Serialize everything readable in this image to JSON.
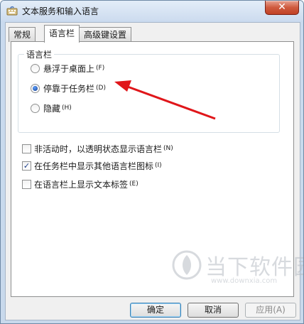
{
  "window": {
    "title": "文本服务和输入语言",
    "close_label": "✕"
  },
  "tabs": [
    {
      "label": "常规",
      "active": false
    },
    {
      "label": "语言栏",
      "active": true
    },
    {
      "label": "高级键设置",
      "active": false
    }
  ],
  "language_bar_group": {
    "label": "语言栏",
    "options": [
      {
        "label": "悬浮于桌面上",
        "accel": "(F)",
        "selected": false
      },
      {
        "label": "停靠于任务栏",
        "accel": "(D)",
        "selected": true
      },
      {
        "label": "隐藏",
        "accel": "(H)",
        "selected": false
      }
    ]
  },
  "checkboxes": [
    {
      "label": "非活动时，以透明状态显示语言栏",
      "accel": "(N)",
      "checked": false
    },
    {
      "label": "在任务栏中显示其他语言栏图标",
      "accel": "(I)",
      "checked": true
    },
    {
      "label": "在语言栏上显示文本标签",
      "accel": "(E)",
      "checked": false
    }
  ],
  "buttons": {
    "ok": "确定",
    "cancel": "取消",
    "apply": "应用(A)"
  },
  "watermark": {
    "text": "当下软件园",
    "url": "www.downxia.com"
  },
  "colors": {
    "annotation_arrow": "#e0161a",
    "title_gradient_top": "#e3edf8",
    "close_button": "#c04125"
  }
}
